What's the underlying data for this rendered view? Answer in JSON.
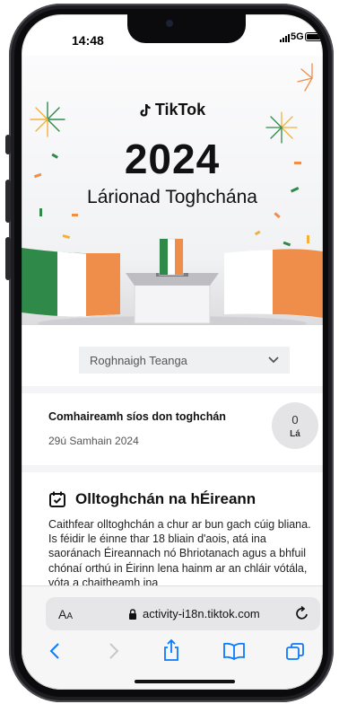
{
  "status_bar": {
    "time": "14:48",
    "network": "5G"
  },
  "brand": {
    "logo_text": "TikTok",
    "accent_green": "#2f8a4a",
    "accent_orange": "#ef8d4a"
  },
  "hero": {
    "year": "2024",
    "subtitle": "Lárionad Toghchána"
  },
  "language_select": {
    "value": "Roghnaigh Teanga"
  },
  "countdown": {
    "title": "Comhaireamh síos don toghchán",
    "date": "29ú Samhain 2024",
    "days": "0",
    "unit": "Lá"
  },
  "article": {
    "title": "Olltoghchán na hÉireann",
    "body": "Caithfear olltoghchán a chur ar bun gach cúig bliana. Is féidir le éinne thar 18 bliain d'aois, atá ina saoránach Éireannach nó Bhriotanach agus a bhfuil chónaí orthú in Éirinn lena hainm ar an chláir vótála, vóta a chaitheamh ina"
  },
  "browser": {
    "text_size_label_small": "A",
    "text_size_label_large": "A",
    "url": "activity-i18n.tiktok.com"
  },
  "icons": [
    "tiktok-note-icon",
    "calendar-check-icon",
    "lock-icon",
    "reload-icon",
    "back-icon",
    "forward-icon",
    "share-icon",
    "bookmarks-icon",
    "tabs-icon"
  ]
}
